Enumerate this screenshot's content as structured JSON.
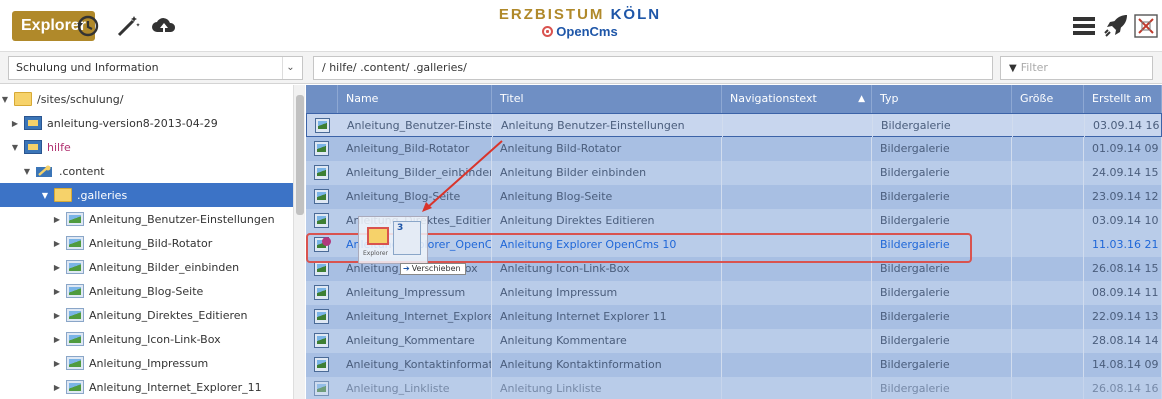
{
  "toolbar": {
    "app_label": "Explorer",
    "brand_title_part1": "ERZBISTUM ",
    "brand_title_part2": "KÖLN",
    "brand_sub": "OpenCms",
    "icons": [
      "history-icon",
      "magic-wand-icon",
      "upload-icon",
      "menu-icon",
      "rocket-icon",
      "close-app-icon"
    ]
  },
  "filterbar": {
    "site_value": "Schulung und Information",
    "path_value": "/ hilfe/ .content/ .galleries/",
    "filter_placeholder": "Filter"
  },
  "tree": {
    "items": [
      {
        "label": "/sites/schulung/",
        "icon": "folder-icon",
        "state": "expanded"
      },
      {
        "label": "anleitung-version8-2013-04-29",
        "icon": "subsite-folder-icon",
        "state": "collapsed"
      },
      {
        "label": "hilfe",
        "icon": "subsite-folder-icon",
        "state": "expanded",
        "color": "#b0306f"
      },
      {
        "label": ".content",
        "icon": "wrench-folder-icon",
        "state": "expanded"
      },
      {
        "label": ".galleries",
        "icon": "folder-icon",
        "state": "expanded",
        "selected": true
      },
      {
        "label": "Anleitung_Benutzer-Einstellungen",
        "icon": "gallery-icon",
        "state": "collapsed"
      },
      {
        "label": "Anleitung_Bild-Rotator",
        "icon": "gallery-icon",
        "state": "collapsed"
      },
      {
        "label": "Anleitung_Bilder_einbinden",
        "icon": "gallery-icon",
        "state": "collapsed"
      },
      {
        "label": "Anleitung_Blog-Seite",
        "icon": "gallery-icon",
        "state": "collapsed"
      },
      {
        "label": "Anleitung_Direktes_Editieren",
        "icon": "gallery-icon",
        "state": "collapsed"
      },
      {
        "label": "Anleitung_Icon-Link-Box",
        "icon": "gallery-icon",
        "state": "collapsed"
      },
      {
        "label": "Anleitung_Impressum",
        "icon": "gallery-icon",
        "state": "collapsed"
      },
      {
        "label": "Anleitung_Internet_Explorer_11",
        "icon": "gallery-icon",
        "state": "collapsed"
      }
    ]
  },
  "table": {
    "columns": [
      "Name",
      "Titel",
      "Navigationstext",
      "Typ",
      "Größe",
      "Erstellt am"
    ],
    "sort_indicator": "▲",
    "rows": [
      {
        "name": "Anleitung_Benutzer-Einstellur",
        "title": "Anleitung Benutzer-Einstellungen",
        "nav": "",
        "type": "Bildergalerie",
        "size": "",
        "created": "03.09.14 16"
      },
      {
        "name": "Anleitung_Bild-Rotator",
        "title": "Anleitung Bild-Rotator",
        "nav": "",
        "type": "Bildergalerie",
        "size": "",
        "created": "01.09.14 09"
      },
      {
        "name": "Anleitung_Bilder_einbinden",
        "title": "Anleitung Bilder einbinden",
        "nav": "",
        "type": "Bildergalerie",
        "size": "",
        "created": "24.09.14 15"
      },
      {
        "name": "Anleitung_Blog-Seite",
        "title": "Anleitung Blog-Seite",
        "nav": "",
        "type": "Bildergalerie",
        "size": "",
        "created": "23.09.14 12"
      },
      {
        "name": "Anleitung_Direktes_Editieren",
        "title": "Anleitung Direktes Editieren",
        "nav": "",
        "type": "Bildergalerie",
        "size": "",
        "created": "03.09.14 10"
      },
      {
        "name": "Anleitung_Explorer_OpenCms",
        "title": "Anleitung Explorer OpenCms 10",
        "nav": "",
        "type": "Bildergalerie",
        "size": "",
        "created": "11.03.16 21"
      },
      {
        "name": "Anleitung_Icon-Link-Box",
        "title": "Anleitung Icon-Link-Box",
        "nav": "",
        "type": "Bildergalerie",
        "size": "",
        "created": "26.08.14 15"
      },
      {
        "name": "Anleitung_Impressum",
        "title": "Anleitung Impressum",
        "nav": "",
        "type": "Bildergalerie",
        "size": "",
        "created": "08.09.14 11"
      },
      {
        "name": "Anleitung_Internet_Explorer_",
        "title": "Anleitung Internet Explorer 11",
        "nav": "",
        "type": "Bildergalerie",
        "size": "",
        "created": "22.09.14 13"
      },
      {
        "name": "Anleitung_Kommentare",
        "title": "Anleitung Kommentare",
        "nav": "",
        "type": "Bildergalerie",
        "size": "",
        "created": "28.08.14 14"
      },
      {
        "name": "Anleitung_Kontaktinformatioi",
        "title": "Anleitung Kontaktinformation",
        "nav": "",
        "type": "Bildergalerie",
        "size": "",
        "created": "14.08.14 09"
      },
      {
        "name": "Anleitung_Linkliste",
        "title": "Anleitung Linkliste",
        "nav": "",
        "type": "Bildergalerie",
        "size": "",
        "created": "26.08.14 16"
      }
    ]
  },
  "drag": {
    "tooltip": "Verschieben",
    "ghost_label": "Explorer",
    "ghost_count": "3"
  },
  "colors": {
    "accent": "#b0892a",
    "brand_blue": "#1e56a8",
    "selection": "#3c73c6",
    "header": "#6f8fc4",
    "highlight": "#d9534f"
  }
}
